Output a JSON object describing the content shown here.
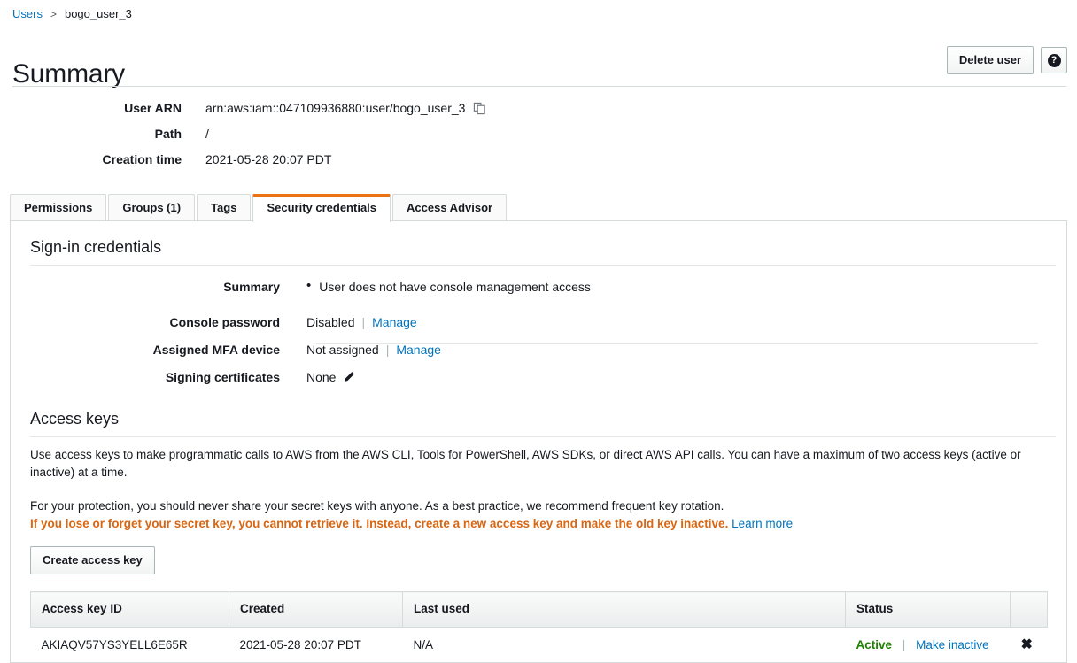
{
  "breadcrumb": {
    "root_label": "Users",
    "separator": ">",
    "current_label": "bogo_user_3"
  },
  "header": {
    "title": "Summary",
    "delete_user_label": "Delete user",
    "help_label": "?"
  },
  "summary": {
    "fields": [
      {
        "label": "User ARN",
        "value": "arn:aws:iam::047109936880:user/bogo_user_3",
        "icon": "copy-icon"
      },
      {
        "label": "Path",
        "value": "/"
      },
      {
        "label": "Creation time",
        "value": "2021-05-28 20:07 PDT"
      }
    ]
  },
  "tabs": [
    {
      "label": "Permissions",
      "active": false
    },
    {
      "label": "Groups (1)",
      "active": false
    },
    {
      "label": "Tags",
      "active": false
    },
    {
      "label": "Security credentials",
      "active": true
    },
    {
      "label": "Access Advisor",
      "active": false
    }
  ],
  "signin_credentials": {
    "heading": "Sign-in credentials",
    "summary_label": "Summary",
    "summary_bullet": "User does not have console management access",
    "console_password_label": "Console password",
    "console_password_value": "Disabled",
    "console_password_action": "Manage",
    "mfa_label": "Assigned MFA device",
    "mfa_value": "Not assigned",
    "mfa_action": "Manage",
    "signing_certs_label": "Signing certificates",
    "signing_certs_value": "None",
    "signing_certs_icon": "pencil-icon"
  },
  "access_keys": {
    "heading": "Access keys",
    "paragraph_1": "Use access keys to make programmatic calls to AWS from the AWS CLI, Tools for PowerShell, AWS SDKs, or direct AWS API calls. You can have a maximum of two access keys (active or inactive) at a time.",
    "paragraph_2_normal": "For your protection, you should never share your secret keys with anyone. As a best practice, we recommend frequent key rotation.",
    "paragraph_2_warning": "If you lose or forget your secret key, you cannot retrieve it. Instead, create a new access key and make the old key inactive.",
    "learn_more_label": "Learn more",
    "create_button_label": "Create access key",
    "warning_color": "#d86613",
    "link_color": "#0073bb",
    "active_color": "#1d8102",
    "table": {
      "columns": [
        "Access key ID",
        "Created",
        "Last used",
        "Status",
        ""
      ],
      "rows": [
        {
          "access_key_id": "AKIAQV57YS3YELL6E65R",
          "created": "2021-05-28 20:07 PDT",
          "last_used": "N/A",
          "status": "Active",
          "status_action": "Make inactive",
          "delete_icon": "close-icon"
        }
      ]
    }
  }
}
